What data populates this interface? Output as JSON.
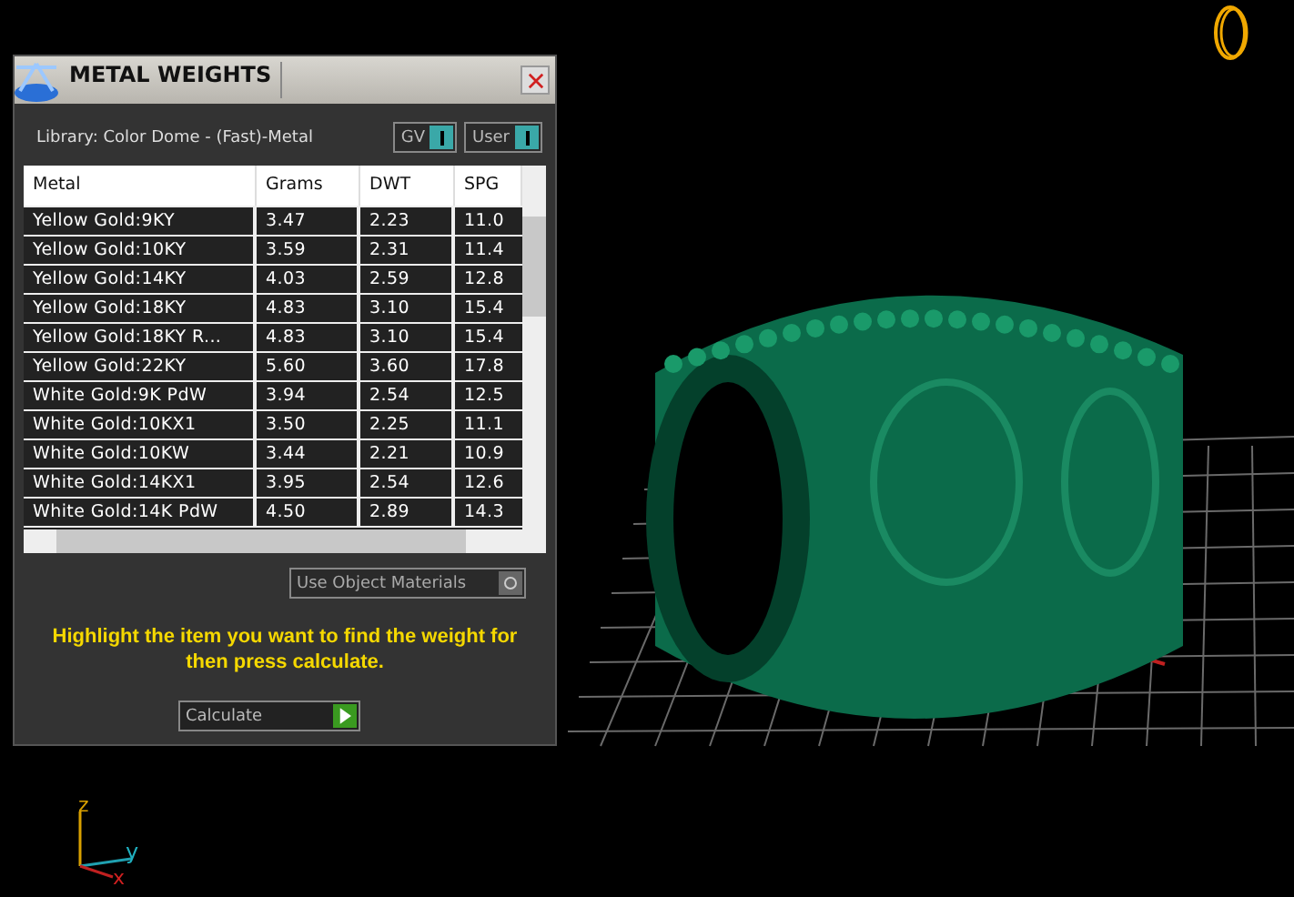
{
  "window": {
    "title": "METAL WEIGHTS"
  },
  "library": "Library: Color Dome - (Fast)-Metal",
  "toggles": [
    {
      "label": "GV",
      "on": true
    },
    {
      "label": "User",
      "on": true
    }
  ],
  "table": {
    "columns": [
      "Metal",
      "Grams",
      "DWT",
      "SPG"
    ],
    "rows": [
      [
        "Yellow Gold:9KY",
        "3.47",
        "2.23",
        "11.0"
      ],
      [
        "Yellow Gold:10KY",
        "3.59",
        "2.31",
        "11.4"
      ],
      [
        "Yellow Gold:14KY",
        "4.03",
        "2.59",
        "12.8"
      ],
      [
        "Yellow Gold:18KY",
        "4.83",
        "3.10",
        "15.4"
      ],
      [
        "Yellow Gold:18KY R...",
        "4.83",
        "3.10",
        "15.4"
      ],
      [
        "Yellow Gold:22KY",
        "5.60",
        "3.60",
        "17.8"
      ],
      [
        "White Gold:9K PdW",
        "3.94",
        "2.54",
        "12.5"
      ],
      [
        "White Gold:10KX1",
        "3.50",
        "2.25",
        "11.1"
      ],
      [
        "White Gold:10KW",
        "3.44",
        "2.21",
        "10.9"
      ],
      [
        "White Gold:14KX1",
        "3.95",
        "2.54",
        "12.6"
      ],
      [
        "White Gold:14K PdW",
        "4.50",
        "2.89",
        "14.3"
      ]
    ]
  },
  "use_object_materials": {
    "label": "Use Object Materials",
    "checked": false
  },
  "hint": "Highlight the item you want to find the weight for then press calculate.",
  "calculate_button": "Calculate",
  "axes": [
    "z",
    "y",
    "x"
  ]
}
